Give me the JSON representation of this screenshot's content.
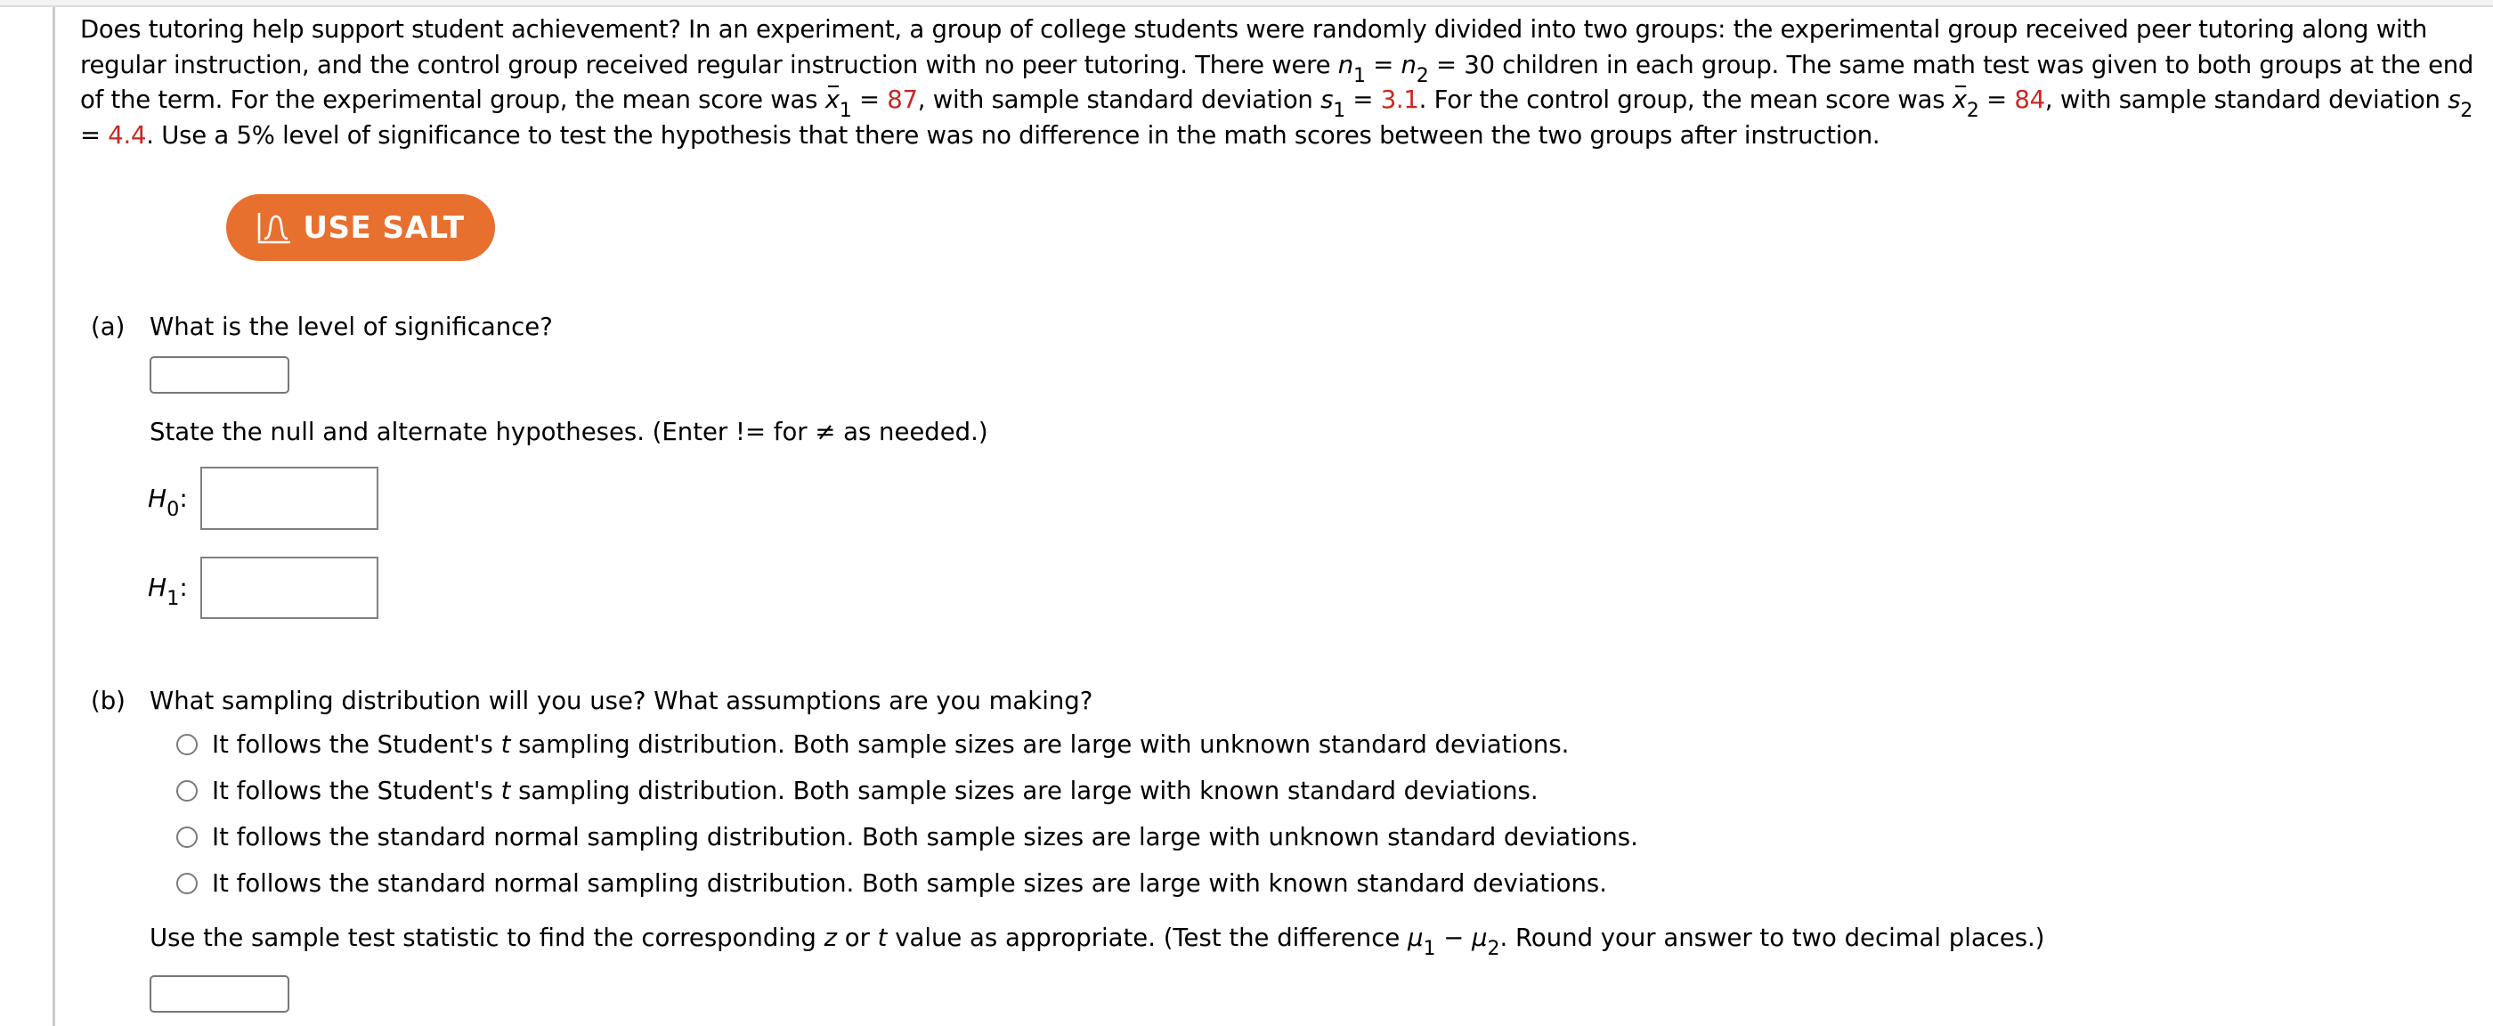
{
  "problem": {
    "intro": "Does tutoring help support student achievement? In an experiment, a group of college students were randomly divided into two groups: the experimental group received peer tutoring along with regular instruction, and the control group received regular instruction with no peer tutoring. There were ",
    "n1_var": "n",
    "n1_sub": "1",
    "eq1": " = ",
    "n2_var": "n",
    "n2_sub": "2",
    "n_value_text": " = 30 children in each group. The same math test was given to both groups at the end of the term. For the experimental group, the mean score was ",
    "x1_var": "x",
    "x1_sub": "1",
    "x1_eq": " = ",
    "x1_value": "87",
    "after_x1": ", with sample standard deviation ",
    "s1_var": "s",
    "s1_sub": "1",
    "s1_eq": " = ",
    "s1_value": "3.1",
    "after_s1": ". For the control group, the mean score was ",
    "x2_var": "x",
    "x2_sub": "2",
    "x2_eq": " = ",
    "x2_value": "84",
    "after_x2": ", with sample standard deviation ",
    "s2_var": "s",
    "s2_sub": "2",
    "s2_eq": " = ",
    "s2_value": "4.4",
    "outro": ". Use a 5% level of significance to test the hypothesis that there was no difference in the math scores between the two groups after instruction."
  },
  "salt_button": {
    "label": "USE SALT",
    "icon": "distribution-curve-icon",
    "color": "#e8702f"
  },
  "part_a": {
    "label": "(a)",
    "question": "What is the level of significance?",
    "significance_input": {
      "value": "",
      "placeholder": ""
    },
    "hypotheses_instruction": "State the null and alternate hypotheses. (Enter != for ≠ as needed.)",
    "h0": {
      "var": "H",
      "sub": "0",
      "colon": ":",
      "value": ""
    },
    "h1": {
      "var": "H",
      "sub": "1",
      "colon": ":",
      "value": ""
    }
  },
  "part_b": {
    "label": "(b)",
    "question": "What sampling distribution will you use? What assumptions are you making?",
    "options": [
      {
        "pre": "It follows the Student's ",
        "var": "t",
        "post": " sampling distribution. Both sample sizes are large with unknown standard deviations.",
        "selected": false
      },
      {
        "pre": "It follows the Student's ",
        "var": "t",
        "post": " sampling distribution. Both sample sizes are large with known standard deviations.",
        "selected": false
      },
      {
        "pre": "It follows the standard normal sampling distribution. Both sample sizes are large with unknown standard deviations.",
        "var": "",
        "post": "",
        "selected": false
      },
      {
        "pre": "It follows the standard normal sampling distribution. Both sample sizes are large with known standard deviations.",
        "var": "",
        "post": "",
        "selected": false
      }
    ],
    "test_stat_instruction": {
      "pre": "Use the sample test statistic to find the corresponding ",
      "z": "z",
      "or": " or ",
      "t": "t",
      "mid": " value as appropriate. (Test the difference ",
      "mu1": "μ",
      "mu1_sub": "1",
      "minus": " − ",
      "mu2": "μ",
      "mu2_sub": "2",
      "post": ". Round your answer to two decimal places.)"
    },
    "test_stat_input": {
      "value": "",
      "placeholder": ""
    }
  },
  "colors": {
    "given_value": "#c8281f",
    "accent": "#e8702f"
  }
}
